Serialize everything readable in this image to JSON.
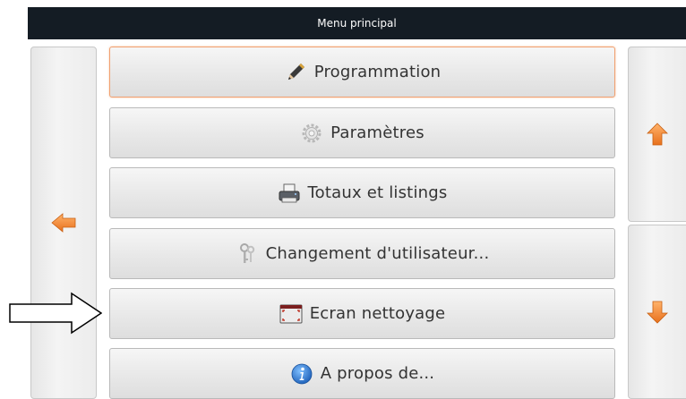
{
  "window": {
    "title": "Menu principal"
  },
  "menu": {
    "items": [
      {
        "label": "Programmation",
        "icon": "pencil-icon",
        "active": true
      },
      {
        "label": "Paramètres",
        "icon": "gear-icon",
        "active": false
      },
      {
        "label": "Totaux et listings",
        "icon": "printer-icon",
        "active": false
      },
      {
        "label": "Changement d'utilisateur...",
        "icon": "keys-icon",
        "active": false
      },
      {
        "label": "Ecran nettoyage",
        "icon": "screen-icon",
        "active": false
      },
      {
        "label": "A propos de...",
        "icon": "info-icon",
        "active": false
      }
    ]
  },
  "navigation": {
    "back_icon": "arrow-left-icon",
    "scroll_up_icon": "arrow-up-icon",
    "scroll_down_icon": "arrow-down-icon",
    "accent_color": "#f08a30"
  },
  "annotation": {
    "icon": "callout-arrow-icon"
  }
}
